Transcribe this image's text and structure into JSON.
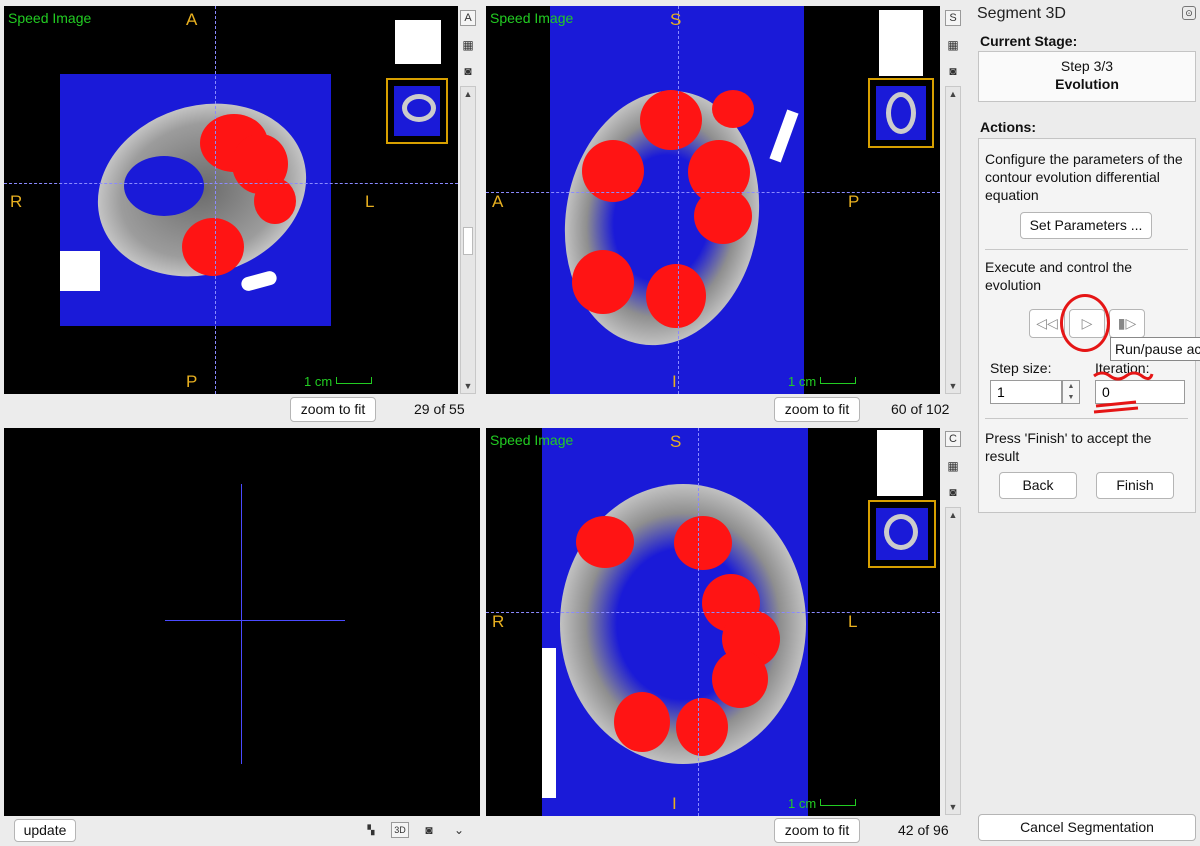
{
  "views": {
    "axial": {
      "label": "Speed Image",
      "top": "A",
      "bottom": "P",
      "left": "R",
      "right": "L",
      "scale": "1 cm",
      "zoom": "zoom to fit",
      "count": "29 of 55",
      "side_letter": "A"
    },
    "sagittal": {
      "label": "Speed Image",
      "top": "S",
      "bottom": "I",
      "left": "A",
      "right": "P",
      "scale": "1 cm",
      "zoom": "zoom to fit",
      "count": "60 of 102",
      "side_letter": "S"
    },
    "coronal": {
      "label": "Speed Image",
      "top": "S",
      "bottom": "I",
      "left": "R",
      "right": "L",
      "scale": "1 cm",
      "zoom": "zoom to fit",
      "count": "42 of 96",
      "side_letter": "C"
    },
    "three_d": {
      "update": "update",
      "btn_3d": "3D"
    }
  },
  "panel": {
    "title": "Segment 3D",
    "current_stage_heading": "Current Stage:",
    "stage_step": "Step 3/3",
    "stage_name": "Evolution",
    "actions_heading": "Actions:",
    "configure_text": "Configure the parameters of the contour evolution differential equation",
    "set_parameters": "Set Parameters ...",
    "execute_text": "Execute and control the evolution",
    "step_size_label": "Step size:",
    "step_size_value": "1",
    "iteration_label": "Iteration:",
    "iteration_value": "0",
    "tooltip": "Run/pause ac",
    "finish_text": "Press 'Finish' to accept the result",
    "back": "Back",
    "finish": "Finish",
    "cancel": "Cancel Segmentation"
  },
  "icons": [
    "layout-icon",
    "camera-icon",
    "rewind-icon",
    "play-icon",
    "step-forward-icon",
    "collapse-chevron-icon",
    "close-panel-icon"
  ],
  "colors": {
    "overlay": "#1a1ad8",
    "segmentation": "#ff1414",
    "label_green": "#22cc22",
    "orientation": "#e8b020",
    "annotation_red": "#e51515"
  }
}
